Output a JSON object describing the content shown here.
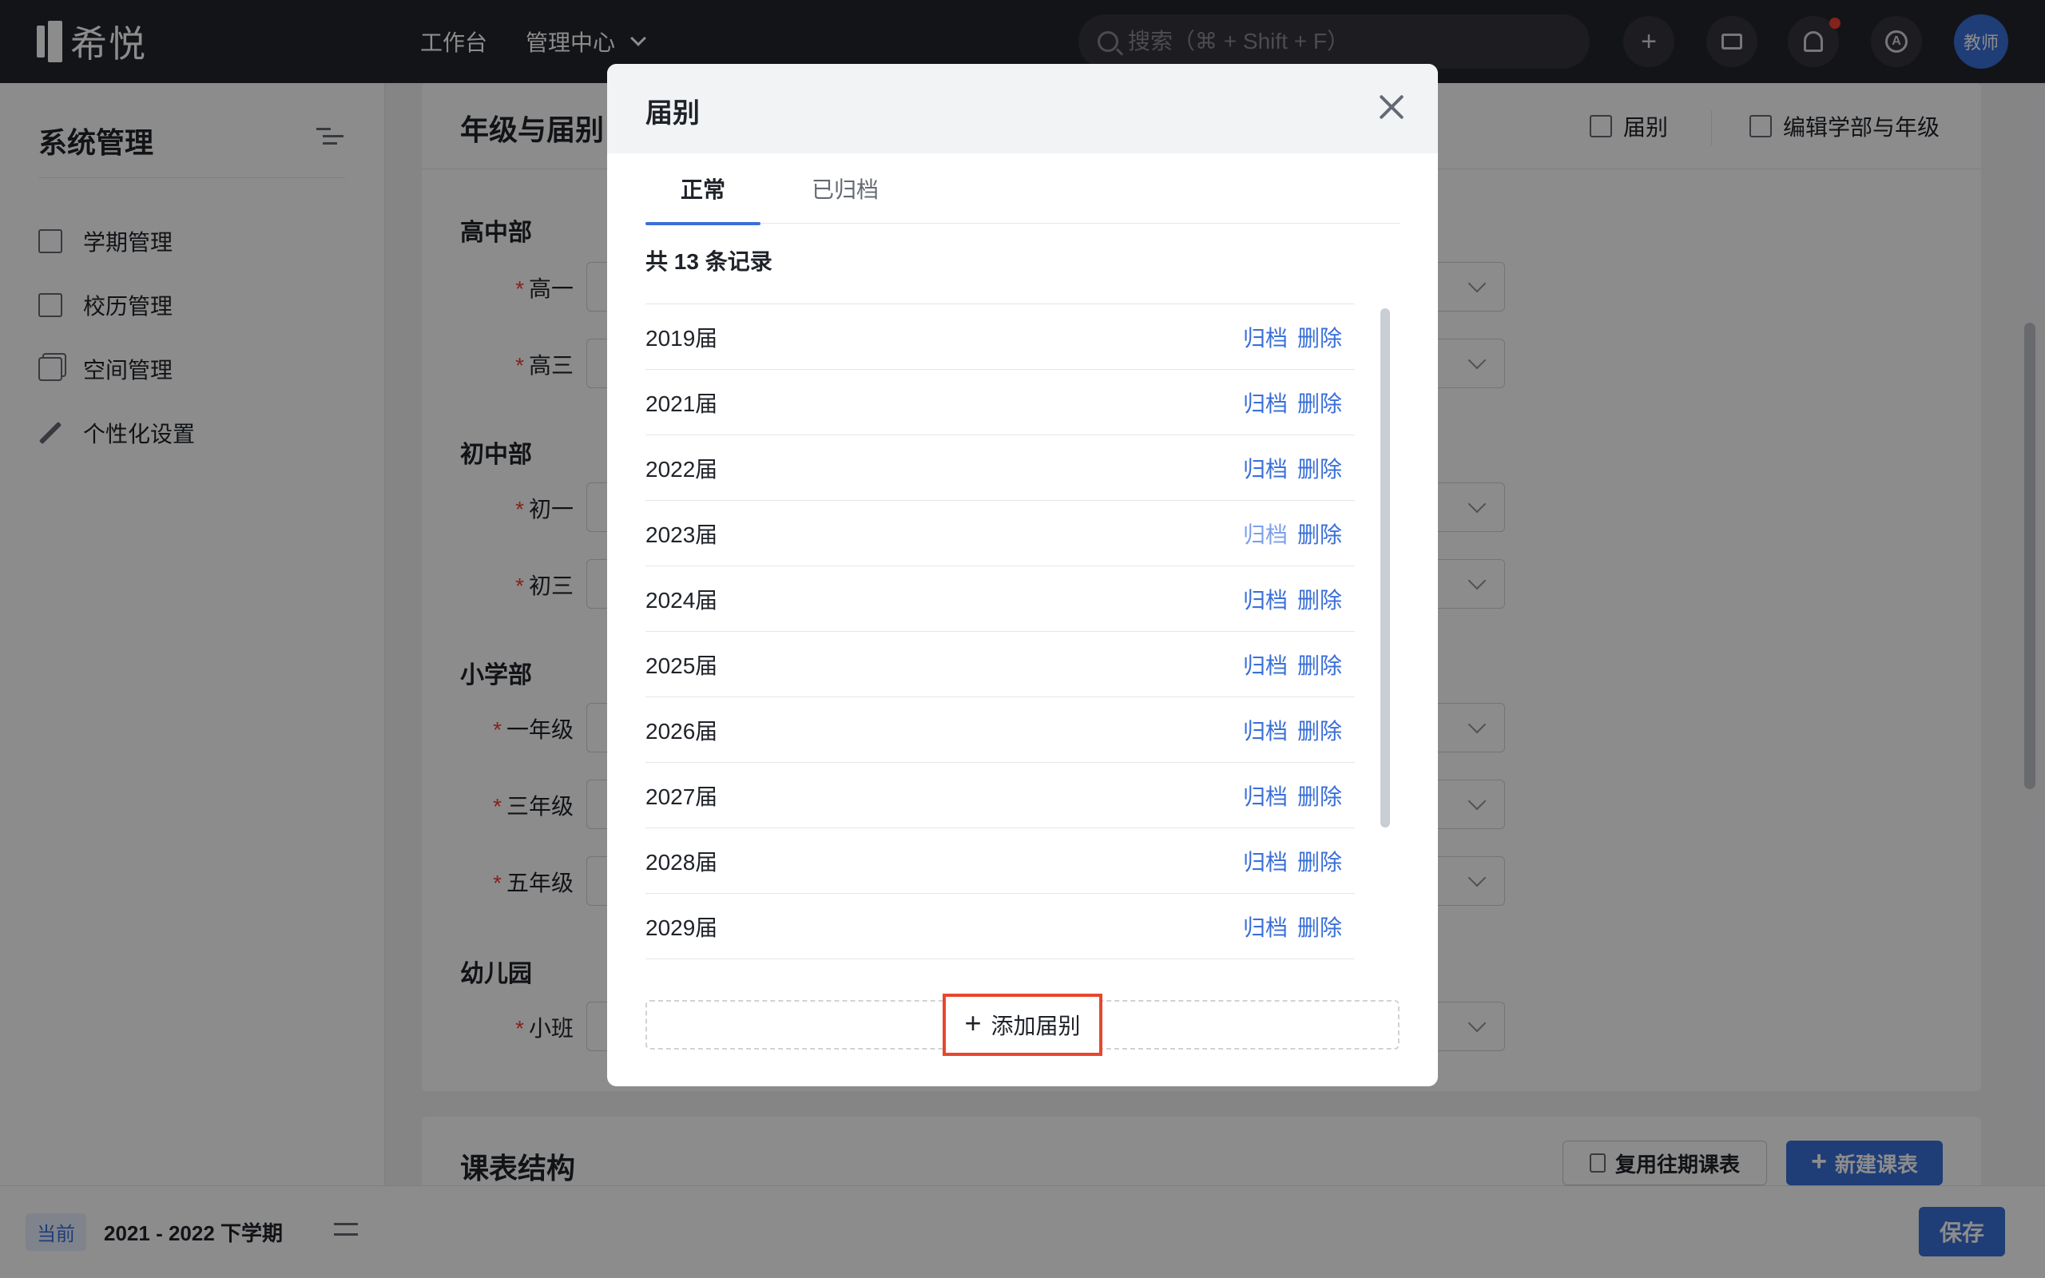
{
  "topbar": {
    "logo_text": "希悦",
    "nav": [
      {
        "label": "工作台"
      },
      {
        "label": "管理中心"
      }
    ],
    "search_placeholder": "搜索（⌘ + Shift + F）",
    "avatar_label": "教师"
  },
  "sidebar": {
    "title": "系统管理",
    "items": [
      {
        "label": "学期管理",
        "icon": "calendar-30-icon"
      },
      {
        "label": "校历管理",
        "icon": "calendar-grid-icon"
      },
      {
        "label": "空间管理",
        "icon": "cube-icon"
      },
      {
        "label": "个性化设置",
        "icon": "pencil-ruler-icon"
      }
    ],
    "term_badge": "当前",
    "term_text": "2021 - 2022 下学期"
  },
  "main": {
    "grade_card": {
      "title": "年级与届别",
      "head_buttons": [
        {
          "label": "届别"
        },
        {
          "label": "编辑学部与年级"
        }
      ],
      "sections": [
        {
          "title": "高中部",
          "rows": [
            "高一",
            "高三"
          ]
        },
        {
          "title": "初中部",
          "rows": [
            "初一",
            "初三"
          ]
        },
        {
          "title": "小学部",
          "rows": [
            "一年级",
            "三年级",
            "五年级"
          ]
        },
        {
          "title": "幼儿园",
          "rows": [
            "小班"
          ]
        }
      ],
      "required_mark": "*"
    },
    "schedule_card": {
      "title": "课表结构",
      "reuse_label": "复用往期课表",
      "new_label": "新建课表"
    },
    "save_label": "保存"
  },
  "modal": {
    "title": "届别",
    "tabs": [
      {
        "label": "正常"
      },
      {
        "label": "已归档"
      }
    ],
    "total_text": "共 13 条记录",
    "rows": [
      {
        "name": "2019届",
        "archive": "归档",
        "delete": "删除"
      },
      {
        "name": "2021届",
        "archive": "归档",
        "delete": "删除"
      },
      {
        "name": "2022届",
        "archive": "归档",
        "delete": "删除"
      },
      {
        "name": "2023届",
        "archive": "归档",
        "delete": "删除"
      },
      {
        "name": "2024届",
        "archive": "归档",
        "delete": "删除"
      },
      {
        "name": "2025届",
        "archive": "归档",
        "delete": "删除"
      },
      {
        "name": "2026届",
        "archive": "归档",
        "delete": "删除"
      },
      {
        "name": "2027届",
        "archive": "归档",
        "delete": "删除"
      },
      {
        "name": "2028届",
        "archive": "归档",
        "delete": "删除"
      },
      {
        "name": "2029届",
        "archive": "归档",
        "delete": "删除"
      }
    ],
    "add_label": "添加届别"
  },
  "colors": {
    "accent": "#3a6fd8",
    "topbar": "#24252b",
    "required": "#f04134",
    "highlight_border": "#e8472e"
  }
}
